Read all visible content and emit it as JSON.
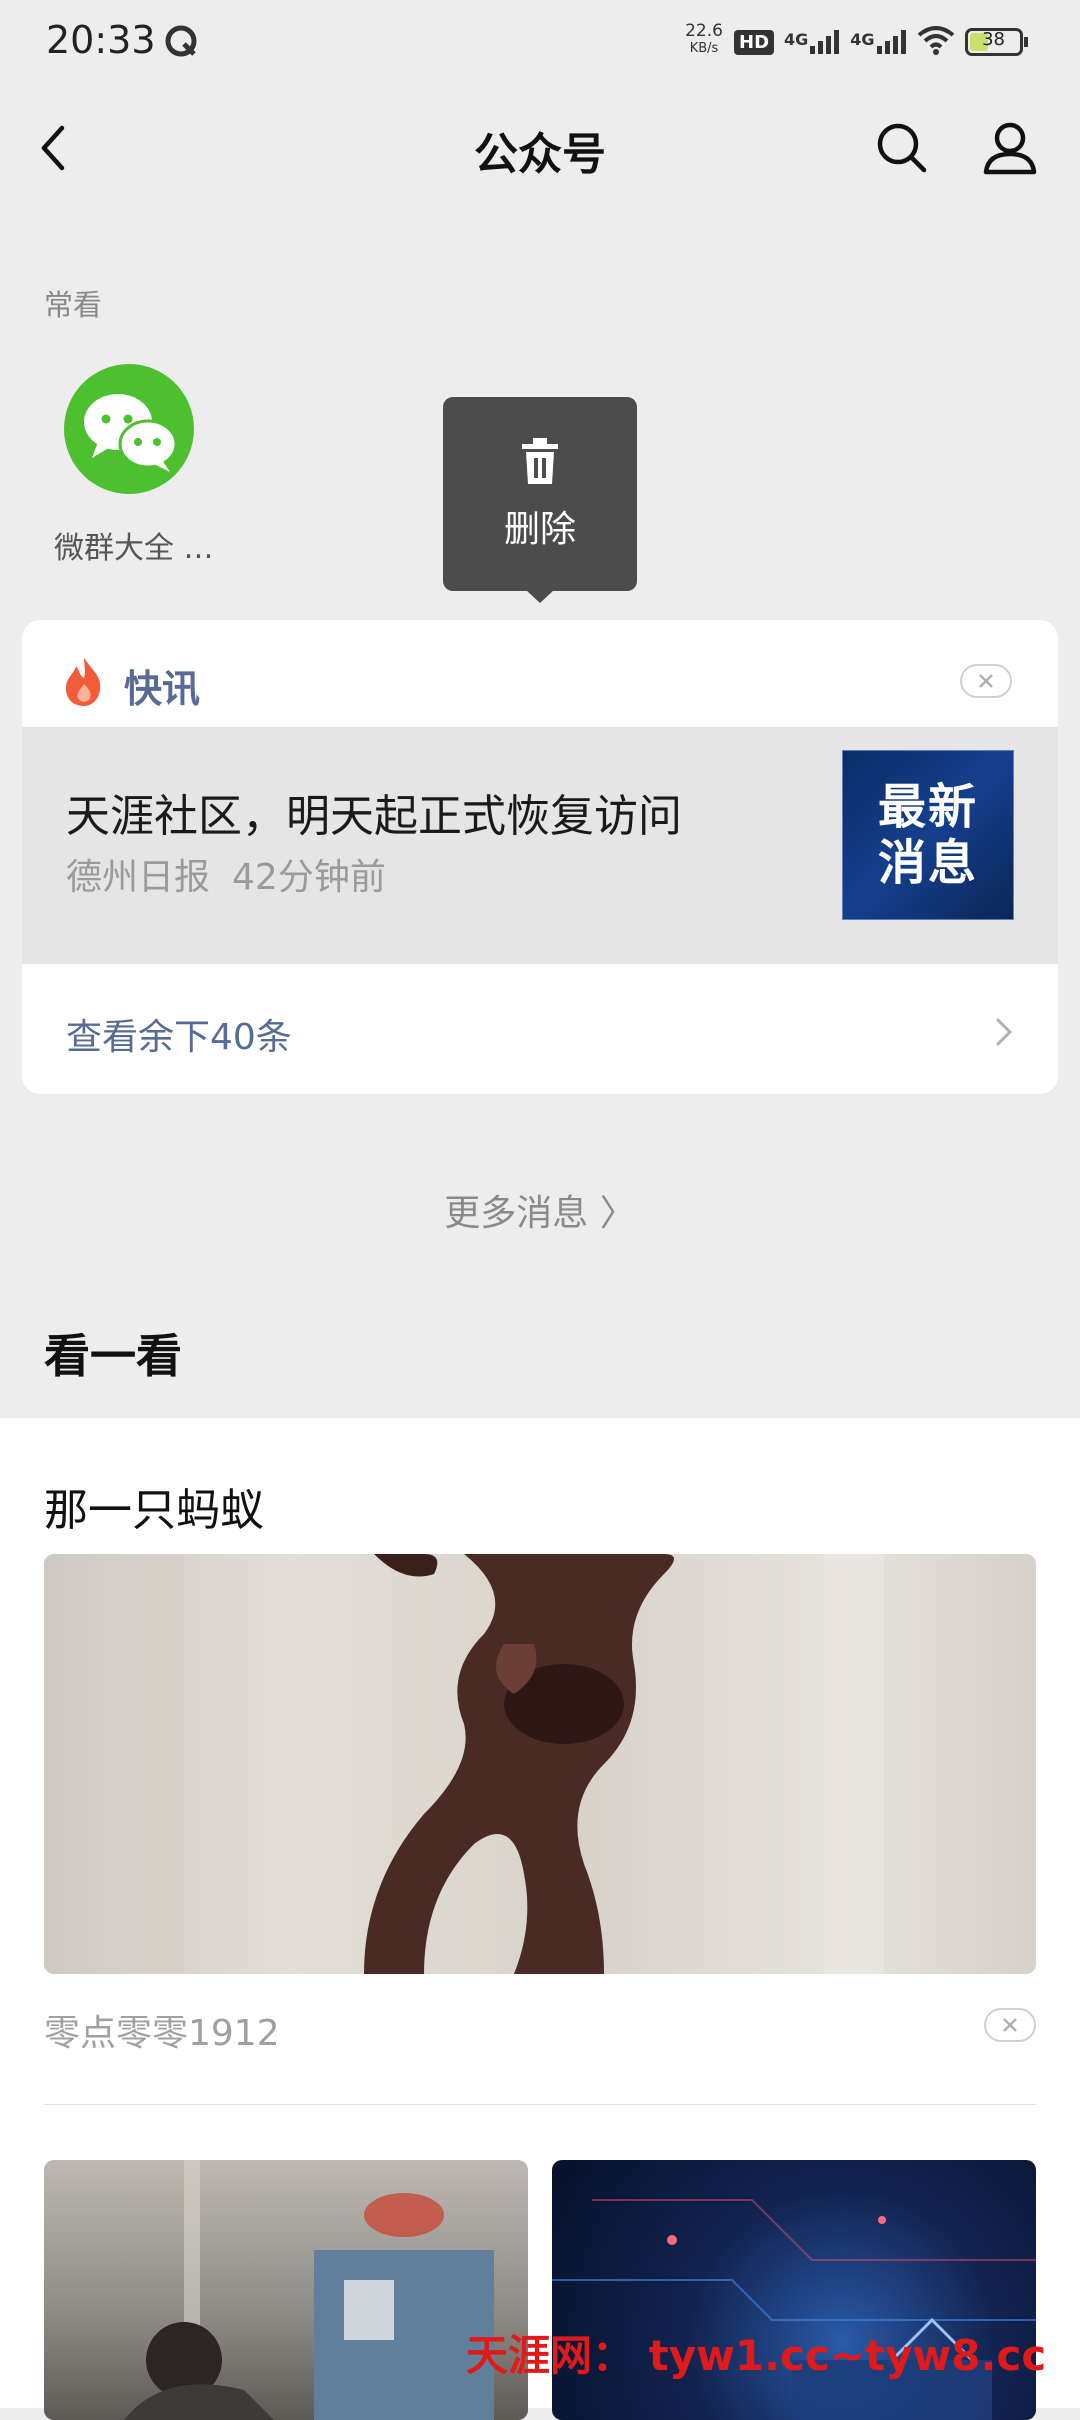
{
  "status_bar": {
    "time": "20:33",
    "net_speed_value": "22.6",
    "net_speed_unit": "KB/s",
    "hd_label": "HD",
    "signal_label": "4G",
    "battery": "38"
  },
  "header": {
    "title": "公众号"
  },
  "frequent": {
    "label": "常看",
    "account_name": "微群大全 …"
  },
  "tooltip": {
    "label": "删除"
  },
  "news": {
    "header_label": "快讯",
    "item_title": "天涯社区，明天起正式恢复访问",
    "item_source": "德州日报",
    "item_time": "42分钟前",
    "thumb_line1": "最新",
    "thumb_line2": "消息",
    "view_more": "查看余下40条"
  },
  "more_messages": "更多消息 〉",
  "look": {
    "header": "看一看",
    "article_title": "那一只蚂蚁",
    "author": "零点零零1912"
  },
  "watermark": "天涯网： tyw1.cc~tyw8.cc",
  "colors": {
    "link_blue": "#576b95",
    "wechat_green": "#4cc02f",
    "background": "#ededed"
  }
}
